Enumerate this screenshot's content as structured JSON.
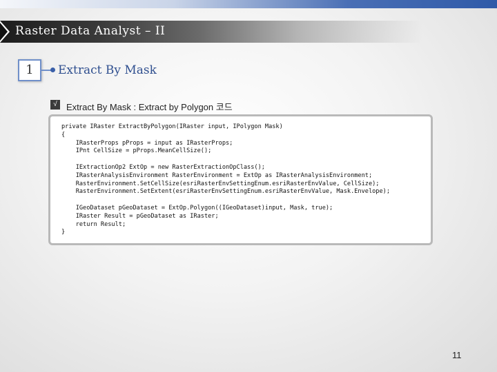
{
  "slide": {
    "title": "Raster Data Analyst – II",
    "section_number": "1",
    "section_title": "Extract By Mask",
    "checkbox_mark": "√",
    "subtitle": "Extract By Mask : Extract by Polygon 코드",
    "page_number": "11",
    "colors": {
      "accent": "#2f4f8f",
      "box_border": "#6f8fc9"
    }
  },
  "code": {
    "lines": [
      "private IRaster ExtractByPolygon(IRaster input, IPolygon Mask)",
      "{",
      "    IRasterProps pProps = input as IRasterProps;",
      "    IPnt CellSize = pProps.MeanCellSize();",
      "",
      "    IExtractionOp2 ExtOp = new RasterExtractionOpClass();",
      "    IRasterAnalysisEnvironment RasterEnvironment = ExtOp as IRasterAnalysisEnvironment;",
      "    RasterEnvironment.SetCellSize(esriRasterEnvSettingEnum.esriRasterEnvValue, CellSize);",
      "    RasterEnvironment.SetExtent(esriRasterEnvSettingEnum.esriRasterEnvValue, Mask.Envelope);",
      "",
      "    IGeoDataset pGeoDataset = ExtOp.Polygon((IGeoDataset)input, Mask, true);",
      "    IRaster Result = pGeoDataset as IRaster;",
      "    return Result;",
      "}"
    ]
  }
}
